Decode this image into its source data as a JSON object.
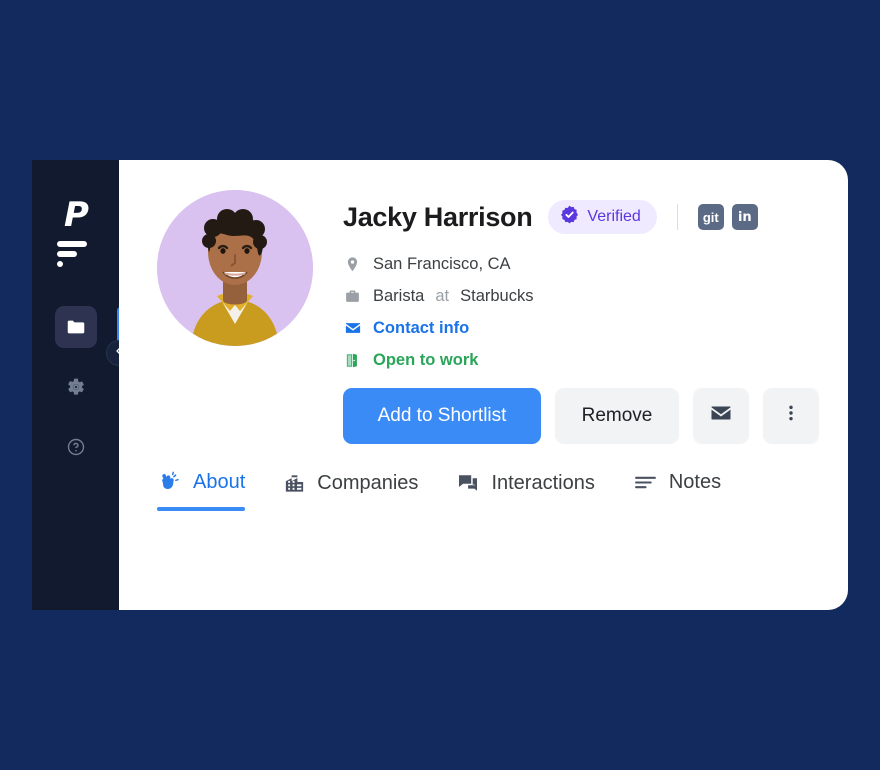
{
  "theme": {
    "page_background": "#132a5e",
    "sidebar_background": "#111a2e",
    "card_background": "#ffffff",
    "accent_blue": "#3b8bf6",
    "link_blue": "#1a73e8",
    "verified_purple": "#5b37e0",
    "verified_pill_bg": "#efeaff",
    "open_green": "#2aa559",
    "avatar_background": "#d9c2f0",
    "social_chip_bg": "#5b6b86",
    "active_nav_bg": "#2d3350"
  },
  "sidebar": {
    "logo_letter": "P",
    "logo_name": "logo-p-bars",
    "collapse_toggle_icon": "chevron-left-icon",
    "items": [
      {
        "id": "folder",
        "icon": "folder-icon",
        "active": true
      },
      {
        "id": "settings",
        "icon": "gear-icon",
        "active": false
      },
      {
        "id": "help",
        "icon": "help-circle-icon",
        "active": false
      }
    ]
  },
  "profile": {
    "avatar_alt": "smiling-woman-short-curly-hair-mustard-shirt",
    "name": "Jacky Harrison",
    "verified": {
      "label": "Verified",
      "icon": "verified-badge-icon"
    },
    "socials": [
      {
        "id": "github",
        "label": "git",
        "icon": "github-icon"
      },
      {
        "id": "linkedin",
        "label": "in",
        "icon": "linkedin-icon"
      }
    ],
    "meta": [
      {
        "id": "location",
        "icon": "location-pin-icon",
        "text": "San Francisco, CA"
      },
      {
        "id": "job",
        "icon": "briefcase-icon",
        "role": "Barista",
        "connector": "at",
        "company": "Starbucks"
      },
      {
        "id": "contact",
        "icon": "envelope-icon",
        "text": "Contact info"
      },
      {
        "id": "open-to-work",
        "icon": "open-door-icon",
        "text": "Open to work"
      }
    ]
  },
  "actions": {
    "primary": "Add to Shortlist",
    "secondary": "Remove",
    "email_icon": "envelope-icon",
    "more_icon": "more-vertical-icon"
  },
  "tabs": [
    {
      "id": "about",
      "label": "About",
      "icon": "waving-hand-icon",
      "active": true
    },
    {
      "id": "companies",
      "label": "Companies",
      "icon": "building-icon",
      "active": false
    },
    {
      "id": "interactions",
      "label": "Interactions",
      "icon": "chat-bubbles-icon",
      "active": false
    },
    {
      "id": "notes",
      "label": "Notes",
      "icon": "lines-icon",
      "active": false
    }
  ]
}
